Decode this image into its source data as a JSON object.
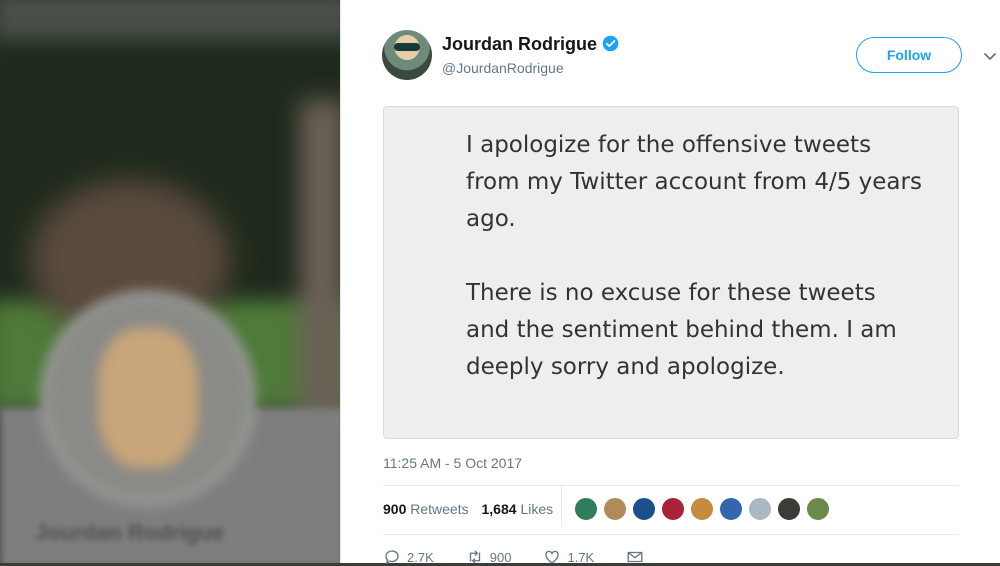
{
  "background": {
    "blurred_name": "Jourdan Rodrigue"
  },
  "tweet": {
    "display_name": "Jourdan Rodrigue",
    "handle": "@JourdanRodrigue",
    "verified": true,
    "follow_label": "Follow",
    "image_text": "I apologize for the offensive tweets from my Twitter account from 4/5 years ago.\n\nThere is no excuse for these tweets and the sentiment behind them. I am deeply sorry and apologize.",
    "timestamp": "11:25 AM - 5 Oct 2017",
    "retweet_count": "900",
    "retweet_label": "Retweets",
    "like_count": "1,684",
    "like_label": "Likes",
    "likers": [
      "#2e7d5b",
      "#b08a5a",
      "#1d4f8c",
      "#a8233a",
      "#c58b3f",
      "#3366aa",
      "#aab8c2",
      "#3b3b38",
      "#6b8a4a"
    ],
    "actions": {
      "reply_count": "2.7K",
      "retweet_count": "900",
      "like_count": "1.7K"
    }
  },
  "colors": {
    "accent": "#1da1f2",
    "text": "#14171a",
    "muted": "#657786"
  }
}
